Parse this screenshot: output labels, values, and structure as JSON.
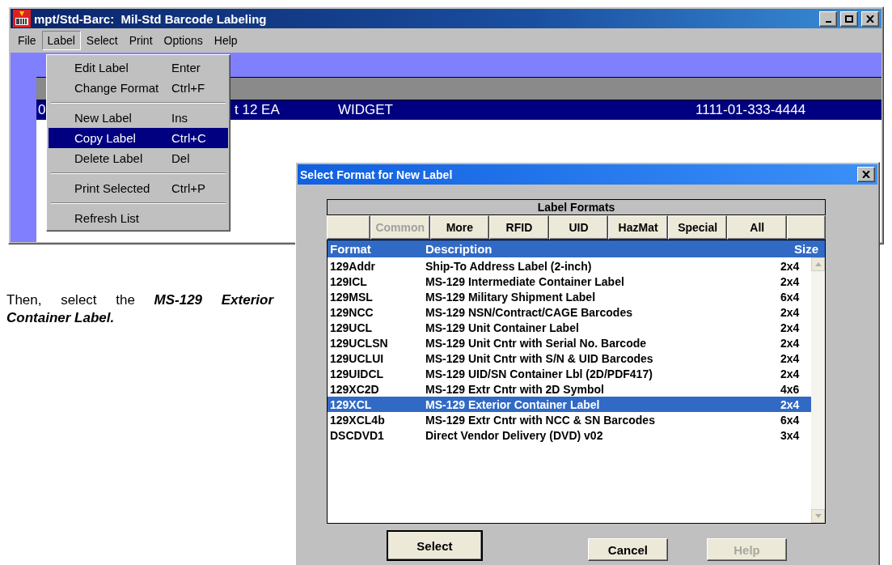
{
  "window": {
    "title": "mpt/Std-Barc:  Mil-Std Barcode Labeling"
  },
  "menu_bar": [
    {
      "label": "File",
      "selected": false
    },
    {
      "label": "Label",
      "selected": true
    },
    {
      "label": "Select",
      "selected": false
    },
    {
      "label": "Print",
      "selected": false
    },
    {
      "label": "Options",
      "selected": false
    },
    {
      "label": "Help",
      "selected": false
    }
  ],
  "label_menu": [
    {
      "kind": "item",
      "label": "Edit Label",
      "shortcut": "Enter",
      "selected": false
    },
    {
      "kind": "item",
      "label": "Change Format",
      "shortcut": "Ctrl+F",
      "selected": false
    },
    {
      "kind": "separator"
    },
    {
      "kind": "item",
      "label": "New Label",
      "shortcut": "Ins",
      "selected": false
    },
    {
      "kind": "item",
      "label": "Copy Label",
      "shortcut": "Ctrl+C",
      "selected": true
    },
    {
      "kind": "item",
      "label": "Delete Label",
      "shortcut": "Del",
      "selected": false
    },
    {
      "kind": "separator"
    },
    {
      "kind": "item",
      "label": "Print Selected",
      "shortcut": "Ctrl+P",
      "selected": false
    },
    {
      "kind": "separator"
    },
    {
      "kind": "item",
      "label": "Refresh List",
      "selected": false
    }
  ],
  "label_list": {
    "rows": [
      {
        "column_1": "0",
        "column_2": "t 12 EA",
        "column_3": "WIDGET",
        "column_4": "1111-01-333-4444",
        "selected": true
      }
    ]
  },
  "instruction": "Then, select the **MS-129 Exterior Container Label.**",
  "dialog": {
    "title": "Select Format for New Label",
    "group_title": "Label Formats",
    "tabs": [
      {
        "label": "Common",
        "disabled": true
      },
      {
        "label": "More",
        "disabled": false
      },
      {
        "label": "RFID",
        "disabled": false
      },
      {
        "label": "UID",
        "disabled": false
      },
      {
        "label": "HazMat",
        "disabled": false
      },
      {
        "label": "Special",
        "disabled": false
      },
      {
        "label": "All",
        "disabled": false
      }
    ],
    "columns": [
      "Format",
      "Description",
      "Size"
    ],
    "rows": [
      {
        "format": "129Addr",
        "description": "Ship-To Address Label (2-inch)",
        "size": "2x4",
        "selected": false
      },
      {
        "format": "129ICL",
        "description": "MS-129 Intermediate Container Label",
        "size": "2x4",
        "selected": false
      },
      {
        "format": "129MSL",
        "description": "MS-129 Military Shipment Label",
        "size": "6x4",
        "selected": false
      },
      {
        "format": "129NCC",
        "description": "MS-129 NSN/Contract/CAGE Barcodes",
        "size": "2x4",
        "selected": false
      },
      {
        "format": "129UCL",
        "description": "MS-129 Unit Container Label",
        "size": "2x4",
        "selected": false
      },
      {
        "format": "129UCLSN",
        "description": "MS-129 Unit Cntr with Serial No. Barcode",
        "size": "2x4",
        "selected": false
      },
      {
        "format": "129UCLUI",
        "description": "MS-129 Unit Cntr with S/N & UID Barcodes",
        "size": "2x4",
        "selected": false
      },
      {
        "format": "129UIDCL",
        "description": "MS-129 UID/SN Container Lbl (2D/PDF417)",
        "size": "2x4",
        "selected": false
      },
      {
        "format": "129XC2D",
        "description": "MS-129 Extr Cntr with 2D Symbol",
        "size": "4x6",
        "selected": false
      },
      {
        "format": "129XCL",
        "description": "MS-129 Exterior Container Label",
        "size": "2x4",
        "selected": true
      },
      {
        "format": "129XCL4b",
        "description": "MS-129 Extr Cntr with NCC & SN Barcodes",
        "size": "6x4",
        "selected": false
      },
      {
        "format": "DSCDVD1",
        "description": "Direct Vendor Delivery (DVD) v02",
        "size": "3x4",
        "selected": false
      }
    ],
    "buttons": [
      {
        "label": "Select",
        "kind": "default",
        "disabled": false
      },
      {
        "label": "Cancel",
        "kind": "normal",
        "disabled": false
      },
      {
        "label": "Help",
        "kind": "normal",
        "disabled": true
      }
    ]
  }
}
